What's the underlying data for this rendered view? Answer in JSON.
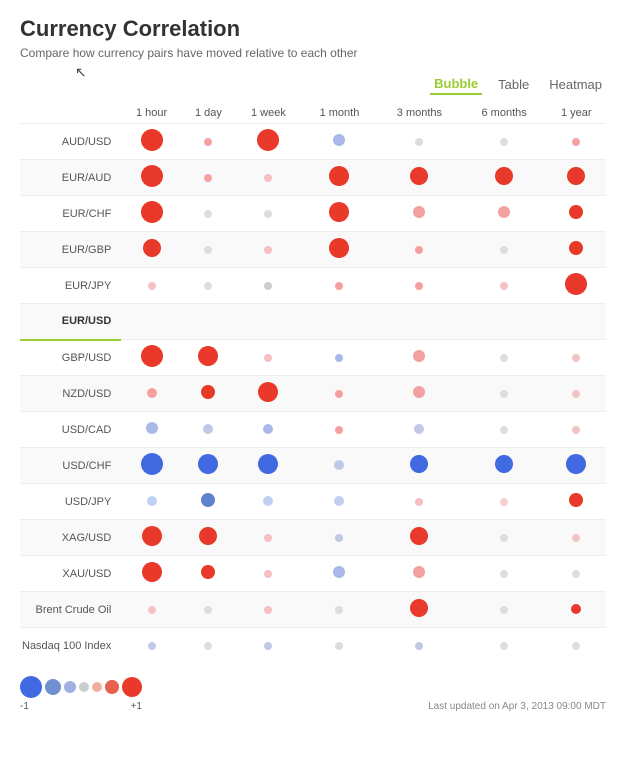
{
  "title": "Currency Correlation",
  "subtitle": "Compare how currency pairs have moved relative to each other",
  "viewToggle": {
    "options": [
      "Bubble",
      "Table",
      "Heatmap"
    ],
    "active": "Bubble"
  },
  "columns": [
    "1 hour",
    "1 day",
    "1 week",
    "1 month",
    "3 months",
    "6 months",
    "1 year"
  ],
  "rows": [
    {
      "label": "AUD/USD",
      "highlighted": false,
      "values": [
        {
          "size": 22,
          "color": "#e8392b"
        },
        {
          "size": 8,
          "color": "#f4a0a0"
        },
        {
          "size": 22,
          "color": "#e8392b"
        },
        {
          "size": 12,
          "color": "#a8b8e8"
        },
        {
          "size": 8,
          "color": "#ddd"
        },
        {
          "size": 8,
          "color": "#ddd"
        },
        {
          "size": 8,
          "color": "#f4a0a0"
        }
      ]
    },
    {
      "label": "EUR/AUD",
      "highlighted": false,
      "values": [
        {
          "size": 22,
          "color": "#e8392b"
        },
        {
          "size": 8,
          "color": "#f4a0a0"
        },
        {
          "size": 8,
          "color": "#f4c0c0"
        },
        {
          "size": 20,
          "color": "#e8392b"
        },
        {
          "size": 18,
          "color": "#e8392b"
        },
        {
          "size": 18,
          "color": "#e8392b"
        },
        {
          "size": 18,
          "color": "#e8392b"
        }
      ]
    },
    {
      "label": "EUR/CHF",
      "highlighted": false,
      "values": [
        {
          "size": 22,
          "color": "#e8392b"
        },
        {
          "size": 8,
          "color": "#ddd"
        },
        {
          "size": 8,
          "color": "#ddd"
        },
        {
          "size": 20,
          "color": "#e8392b"
        },
        {
          "size": 12,
          "color": "#f4a0a0"
        },
        {
          "size": 12,
          "color": "#f4a0a0"
        },
        {
          "size": 14,
          "color": "#e8392b"
        }
      ]
    },
    {
      "label": "EUR/GBP",
      "highlighted": false,
      "values": [
        {
          "size": 18,
          "color": "#e8392b"
        },
        {
          "size": 8,
          "color": "#ddd"
        },
        {
          "size": 8,
          "color": "#f4c0c0"
        },
        {
          "size": 20,
          "color": "#e8392b"
        },
        {
          "size": 8,
          "color": "#f4a0a0"
        },
        {
          "size": 8,
          "color": "#ddd"
        },
        {
          "size": 14,
          "color": "#e8392b"
        }
      ]
    },
    {
      "label": "EUR/JPY",
      "highlighted": false,
      "values": [
        {
          "size": 8,
          "color": "#f4c0c0"
        },
        {
          "size": 8,
          "color": "#ddd"
        },
        {
          "size": 8,
          "color": "#ccc"
        },
        {
          "size": 8,
          "color": "#f4a0a0"
        },
        {
          "size": 8,
          "color": "#f4a0a0"
        },
        {
          "size": 8,
          "color": "#f4c0c0"
        },
        {
          "size": 22,
          "color": "#e8392b"
        }
      ]
    },
    {
      "label": "EUR/USD",
      "highlighted": true,
      "values": [
        {
          "size": 0,
          "color": "transparent"
        },
        {
          "size": 0,
          "color": "transparent"
        },
        {
          "size": 0,
          "color": "transparent"
        },
        {
          "size": 0,
          "color": "transparent"
        },
        {
          "size": 0,
          "color": "transparent"
        },
        {
          "size": 0,
          "color": "transparent"
        },
        {
          "size": 0,
          "color": "transparent"
        }
      ]
    },
    {
      "label": "GBP/USD",
      "highlighted": false,
      "values": [
        {
          "size": 22,
          "color": "#e8392b"
        },
        {
          "size": 20,
          "color": "#e8392b"
        },
        {
          "size": 8,
          "color": "#f4c0c0"
        },
        {
          "size": 8,
          "color": "#a8b8e8"
        },
        {
          "size": 12,
          "color": "#f4a0a0"
        },
        {
          "size": 8,
          "color": "#ddd"
        },
        {
          "size": 8,
          "color": "#f4c0c0"
        }
      ]
    },
    {
      "label": "NZD/USD",
      "highlighted": false,
      "values": [
        {
          "size": 10,
          "color": "#f4a0a0"
        },
        {
          "size": 14,
          "color": "#e8392b"
        },
        {
          "size": 20,
          "color": "#e8392b"
        },
        {
          "size": 8,
          "color": "#f4a0a0"
        },
        {
          "size": 12,
          "color": "#f4a0a0"
        },
        {
          "size": 8,
          "color": "#ddd"
        },
        {
          "size": 8,
          "color": "#f4c0c0"
        }
      ]
    },
    {
      "label": "USD/CAD",
      "highlighted": false,
      "values": [
        {
          "size": 12,
          "color": "#a8b8e8"
        },
        {
          "size": 10,
          "color": "#c0c8e8"
        },
        {
          "size": 10,
          "color": "#a8b8e8"
        },
        {
          "size": 8,
          "color": "#f4a0a0"
        },
        {
          "size": 10,
          "color": "#c0c8e8"
        },
        {
          "size": 8,
          "color": "#ddd"
        },
        {
          "size": 8,
          "color": "#f4c0c0"
        }
      ]
    },
    {
      "label": "USD/CHF",
      "highlighted": false,
      "values": [
        {
          "size": 22,
          "color": "#4169e1"
        },
        {
          "size": 20,
          "color": "#4169e1"
        },
        {
          "size": 20,
          "color": "#4169e1"
        },
        {
          "size": 10,
          "color": "#c0c8e8"
        },
        {
          "size": 18,
          "color": "#4169e1"
        },
        {
          "size": 18,
          "color": "#4169e1"
        },
        {
          "size": 20,
          "color": "#4169e1"
        }
      ]
    },
    {
      "label": "USD/JPY",
      "highlighted": false,
      "values": [
        {
          "size": 10,
          "color": "#c0d0f0"
        },
        {
          "size": 14,
          "color": "#6080d0"
        },
        {
          "size": 10,
          "color": "#c0d0f0"
        },
        {
          "size": 10,
          "color": "#c0d0f0"
        },
        {
          "size": 8,
          "color": "#f4c0c0"
        },
        {
          "size": 8,
          "color": "#f4d0d0"
        },
        {
          "size": 14,
          "color": "#e8392b"
        }
      ]
    },
    {
      "label": "XAG/USD",
      "highlighted": false,
      "values": [
        {
          "size": 20,
          "color": "#e8392b"
        },
        {
          "size": 18,
          "color": "#e8392b"
        },
        {
          "size": 8,
          "color": "#f4c0c0"
        },
        {
          "size": 8,
          "color": "#c0c8e8"
        },
        {
          "size": 18,
          "color": "#e8392b"
        },
        {
          "size": 8,
          "color": "#ddd"
        },
        {
          "size": 8,
          "color": "#f4c0c0"
        }
      ]
    },
    {
      "label": "XAU/USD",
      "highlighted": false,
      "values": [
        {
          "size": 20,
          "color": "#e8392b"
        },
        {
          "size": 14,
          "color": "#e8392b"
        },
        {
          "size": 8,
          "color": "#f4c0c0"
        },
        {
          "size": 12,
          "color": "#a8b8e8"
        },
        {
          "size": 12,
          "color": "#f4a0a0"
        },
        {
          "size": 8,
          "color": "#ddd"
        },
        {
          "size": 8,
          "color": "#ddd"
        }
      ]
    },
    {
      "label": "Brent Crude Oil",
      "highlighted": false,
      "values": [
        {
          "size": 8,
          "color": "#f4c0c0"
        },
        {
          "size": 8,
          "color": "#ddd"
        },
        {
          "size": 8,
          "color": "#f4c0c0"
        },
        {
          "size": 8,
          "color": "#ddd"
        },
        {
          "size": 18,
          "color": "#e8392b"
        },
        {
          "size": 8,
          "color": "#ddd"
        },
        {
          "size": 10,
          "color": "#e8392b"
        }
      ]
    },
    {
      "label": "Nasdaq 100 Index",
      "highlighted": false,
      "values": [
        {
          "size": 8,
          "color": "#c0c8e8"
        },
        {
          "size": 8,
          "color": "#ddd"
        },
        {
          "size": 8,
          "color": "#c0c8e8"
        },
        {
          "size": 8,
          "color": "#ddd"
        },
        {
          "size": 8,
          "color": "#c0c8e8"
        },
        {
          "size": 8,
          "color": "#ddd"
        },
        {
          "size": 8,
          "color": "#ddd"
        }
      ]
    }
  ],
  "legend": {
    "minus_label": "-1",
    "plus_label": "+1",
    "bubbles": [
      {
        "size": 22,
        "color": "#4169e1"
      },
      {
        "size": 16,
        "color": "#7090d0"
      },
      {
        "size": 12,
        "color": "#a0b0e0"
      },
      {
        "size": 10,
        "color": "#ccc"
      },
      {
        "size": 10,
        "color": "#f0b0a0"
      },
      {
        "size": 14,
        "color": "#e86050"
      },
      {
        "size": 20,
        "color": "#e8392b"
      }
    ]
  },
  "lastUpdated": "Last updated on Apr 3, 2013 09:00 MDT"
}
